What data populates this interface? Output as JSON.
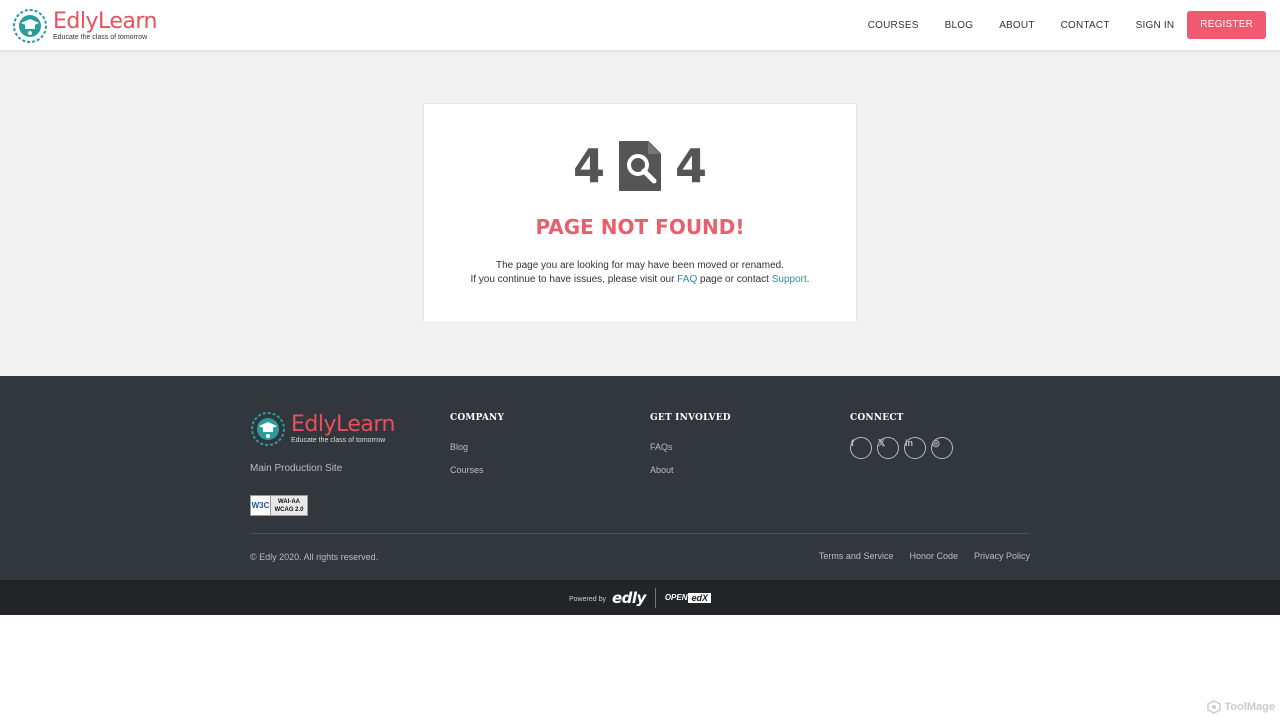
{
  "header": {
    "brand": "EdlyLearn",
    "tagline": "Educate the class of tomorrow",
    "nav": [
      "COURSES",
      "BLOG",
      "ABOUT",
      "CONTACT",
      "SIGN IN"
    ],
    "register": "REGISTER",
    "brand_color": "#e8505b",
    "accent_color": "#f05a6e"
  },
  "error": {
    "digit_left": "4",
    "digit_right": "4",
    "icon": "search-document-icon",
    "title": "PAGE NOT FOUND!",
    "line1": "The page you are looking for may have been moved or renamed.",
    "line2_prefix": "If you continue to have issues, please visit our ",
    "faq_link": "FAQ",
    "line2_mid": " page or contact ",
    "support_link": "Support",
    "line2_suffix": "."
  },
  "footer": {
    "brand": "EdlyLearn",
    "tagline": "Educate the class of tomorrow",
    "site_name": "Main Production Site",
    "wcag_badge": {
      "logo": "W3C",
      "line1": "WAI-AA",
      "line2": "WCAG 2.0"
    },
    "company": {
      "heading": "COMPANY",
      "links": [
        "Blog",
        "Courses"
      ]
    },
    "involved": {
      "heading": "GET INVOLVED",
      "links": [
        "FAQs",
        "About"
      ]
    },
    "connect": {
      "heading": "CONNECT",
      "icons": [
        "facebook-icon",
        "x-twitter-icon",
        "linkedin-icon",
        "instagram-icon"
      ],
      "glyphs": [
        "f",
        "𝕏",
        "in",
        "◎"
      ]
    },
    "copyright": "© Edly 2020. All rights reserved.",
    "legal": [
      "Terms and Service",
      "Honor Code",
      "Privacy Policy"
    ]
  },
  "powered": {
    "label": "Powered by",
    "edly": "edly",
    "open": "OPEN",
    "edx": "edX"
  },
  "watermark": "ToolMage"
}
